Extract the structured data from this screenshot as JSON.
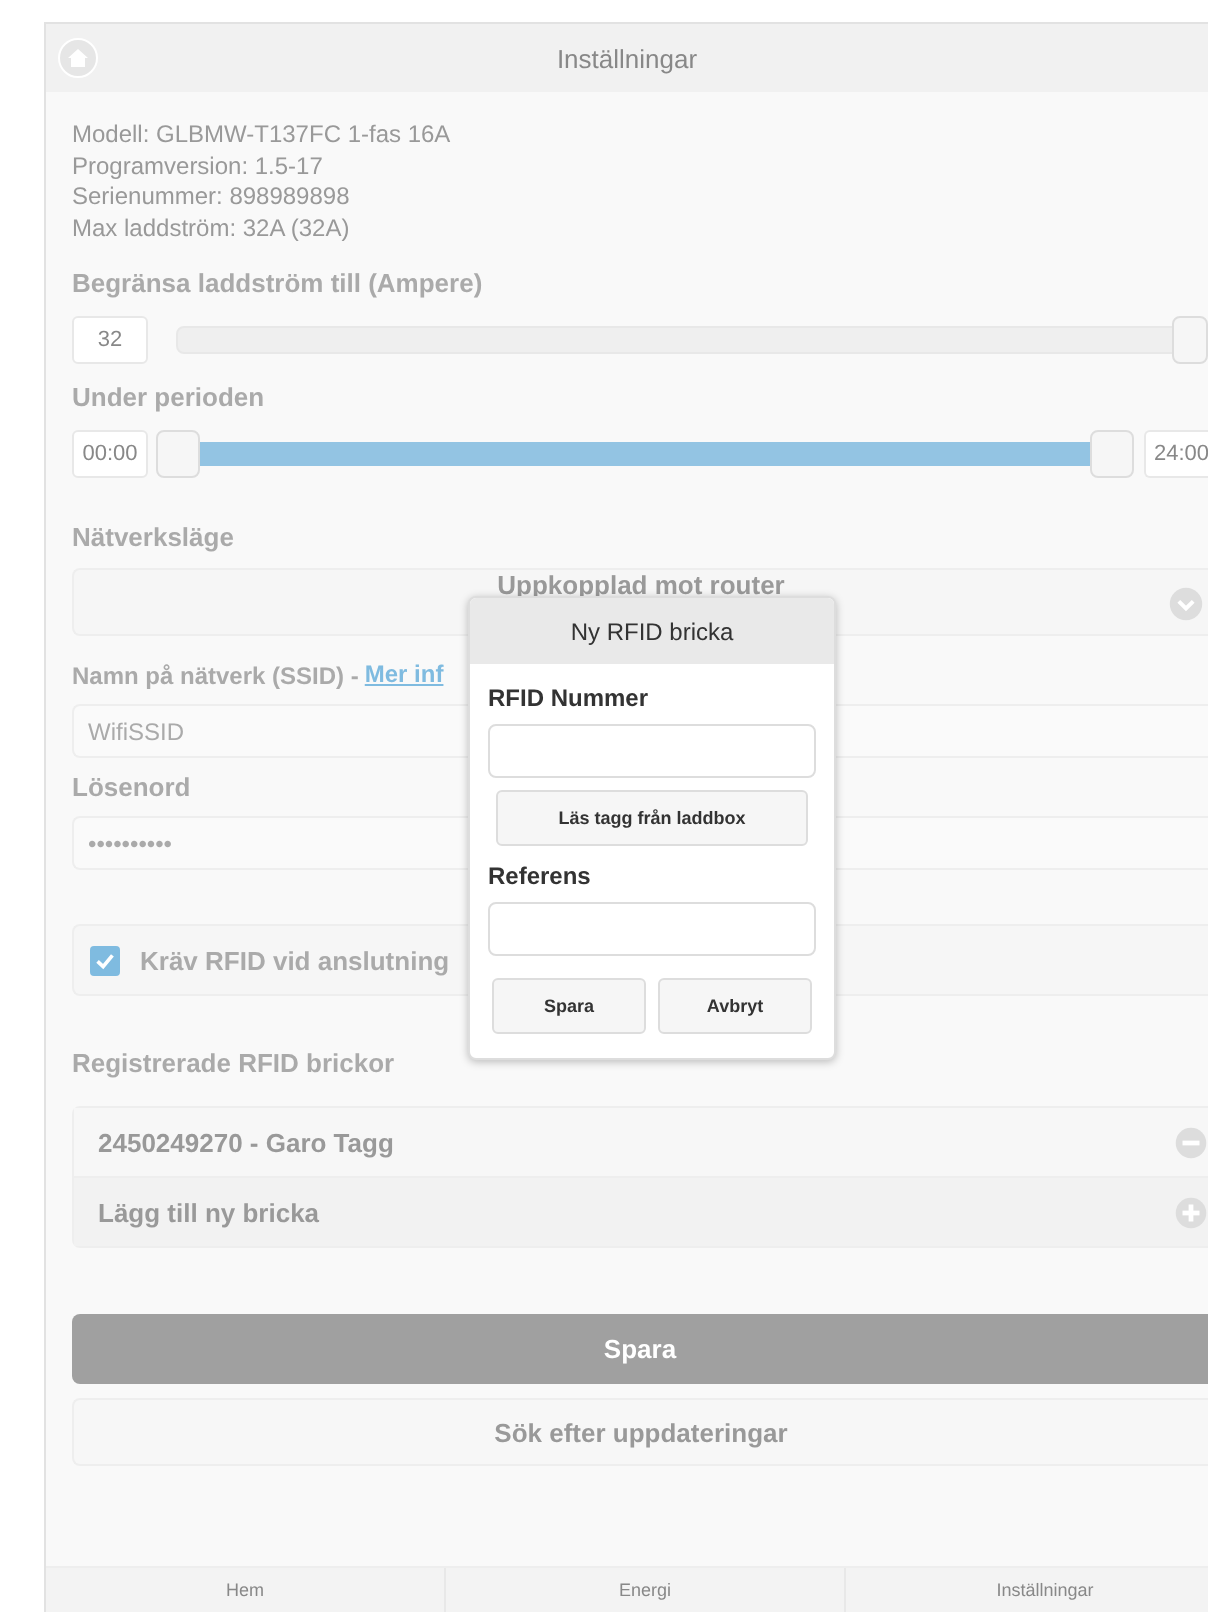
{
  "header": {
    "title": "Inställningar"
  },
  "info": [
    "Modell: GLBMW-T137FC 1-fas 16A",
    "Programversion: 1.5-17",
    "Serienummer: 898989898",
    "Max laddström: 32A (32A)"
  ],
  "limit": {
    "label": "Begränsa laddström till (Ampere)",
    "value": "32",
    "level": 1
  },
  "period": {
    "label": "Under perioden",
    "start": "00:00",
    "end": "24:00",
    "thumbs": [
      {
        "level": 0
      },
      {
        "level": 1
      }
    ]
  },
  "network": {
    "label": "Nätverksläge",
    "value": "Uppkopplad mot router"
  },
  "ssid": {
    "label": "Namn på nätverk (SSID) - ",
    "link": "Mer inf",
    "value": "WifiSSID"
  },
  "password": {
    "label": "Lösenord",
    "value": "••••••••••"
  },
  "require_rfid": {
    "label": "Kräv RFID vid anslutning",
    "checked": true
  },
  "tags": {
    "label": "Registrerade RFID brickor",
    "items": [
      {
        "text": "2450249270 - Garo Tagg",
        "kind": "remove"
      },
      {
        "text": "Lägg till ny bricka",
        "kind": "add"
      }
    ]
  },
  "buttons": [
    {
      "label": "Spara",
      "kind": "primary"
    },
    {
      "label": "Sök efter uppdateringar",
      "kind": "secondary"
    }
  ],
  "footer_tabs": [
    {
      "label": "Hem"
    },
    {
      "label": "Energi"
    },
    {
      "label": "Inställningar"
    }
  ],
  "dialog": {
    "title": "Ny RFID bricka",
    "number_label": "RFID Nummer",
    "read_button": "Läs tagg från laddbox",
    "reference_label": "Referens",
    "buttons": [
      "Spara",
      "Avbryt"
    ]
  }
}
